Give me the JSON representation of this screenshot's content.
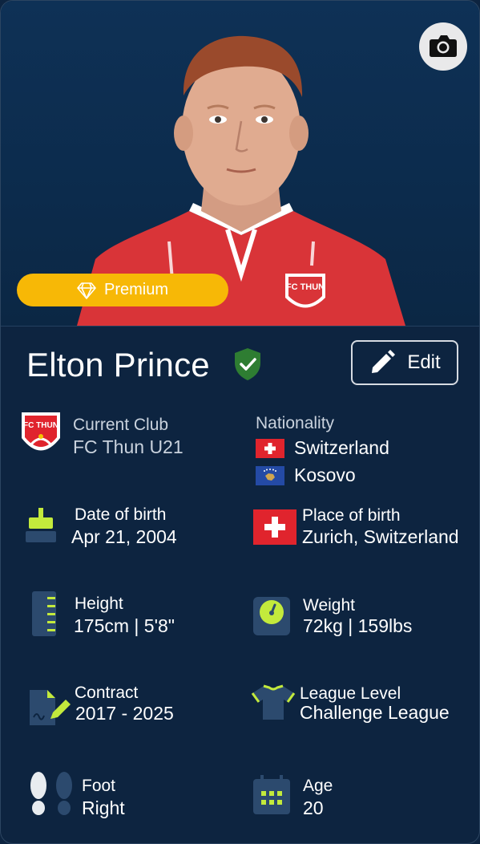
{
  "premium_label": "Premium",
  "player": {
    "name": "Elton Prince",
    "edit_label": "Edit"
  },
  "club": {
    "label": "Current Club",
    "value": "FC Thun U21",
    "logo_text": "FC THUN"
  },
  "nationality": {
    "label": "Nationality",
    "items": [
      "Switzerland",
      "Kosovo"
    ]
  },
  "dob": {
    "label": "Date of birth",
    "value": "Apr 21, 2004"
  },
  "pob": {
    "label": "Place of birth",
    "value": "Zurich, Switzerland"
  },
  "height": {
    "label": "Height",
    "value": "175cm | 5'8\""
  },
  "weight": {
    "label": "Weight",
    "value": "72kg | 159lbs"
  },
  "contract": {
    "label": "Contract",
    "value": "2017 - 2025"
  },
  "league": {
    "label": "League Level",
    "value": "Challenge League"
  },
  "foot": {
    "label": "Foot",
    "value": "Right"
  },
  "age": {
    "label": "Age",
    "value": "20"
  },
  "colors": {
    "background": "#0d2440",
    "premium": "#f7b806",
    "accent_green": "#c3ea3c",
    "icon_blue": "#2c4a6e",
    "verified": "#2e7d32"
  }
}
